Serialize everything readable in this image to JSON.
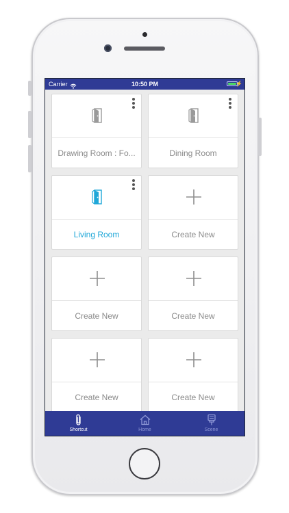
{
  "status_bar": {
    "carrier": "Carrier",
    "time": "10:50 PM"
  },
  "colors": {
    "primary": "#2f3b95",
    "active_accent": "#1fa7d8",
    "inactive_text": "#8a8a8a"
  },
  "tiles": [
    {
      "label": "Drawing Room : Fo...",
      "icon": "door-icon",
      "has_menu": true,
      "active": false
    },
    {
      "label": "Dining Room",
      "icon": "door-icon",
      "has_menu": true,
      "active": false
    },
    {
      "label": "Living Room",
      "icon": "door-icon",
      "has_menu": true,
      "active": true
    },
    {
      "label": "Create New",
      "icon": "plus-icon",
      "has_menu": false,
      "active": false
    },
    {
      "label": "Create New",
      "icon": "plus-icon",
      "has_menu": false,
      "active": false
    },
    {
      "label": "Create New",
      "icon": "plus-icon",
      "has_menu": false,
      "active": false
    },
    {
      "label": "Create New",
      "icon": "plus-icon",
      "has_menu": false,
      "active": false
    },
    {
      "label": "Create New",
      "icon": "plus-icon",
      "has_menu": false,
      "active": false
    }
  ],
  "tabbar": {
    "items": [
      {
        "label": "Shortcut",
        "icon": "paperclip-icon",
        "active": true
      },
      {
        "label": "Home",
        "icon": "home-icon",
        "active": false
      },
      {
        "label": "Scene",
        "icon": "scene-icon",
        "active": false
      }
    ]
  }
}
